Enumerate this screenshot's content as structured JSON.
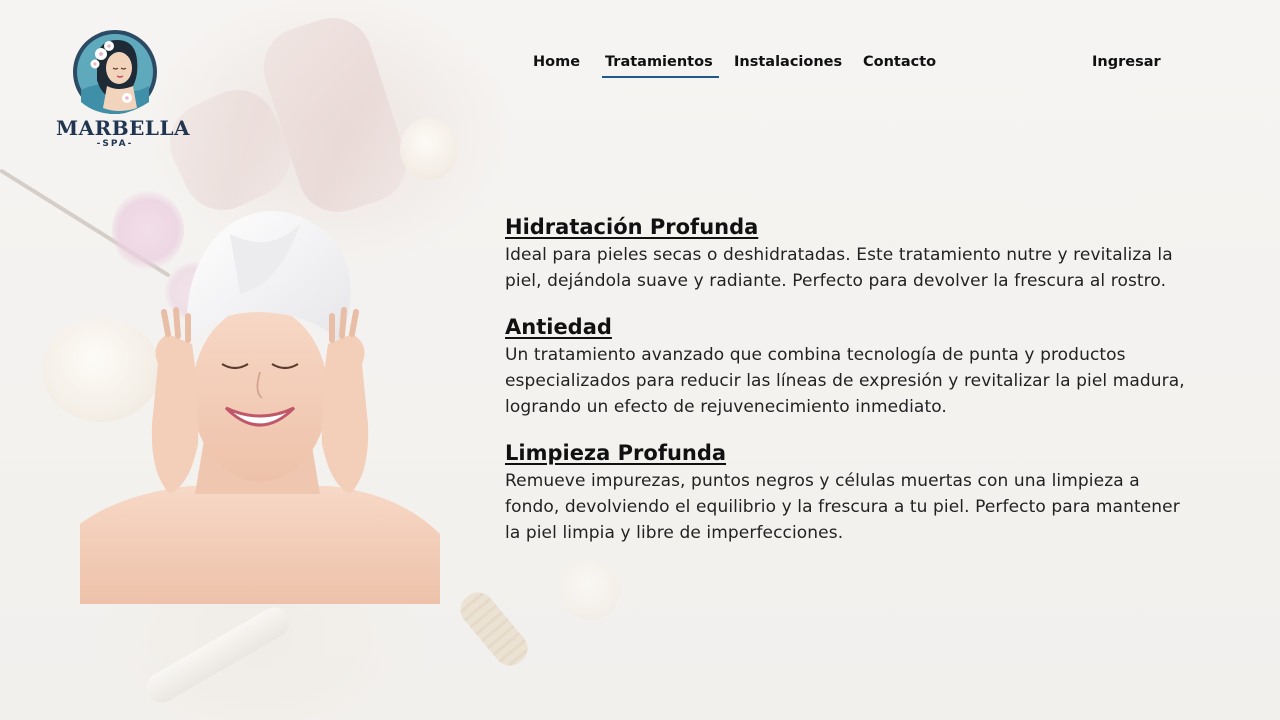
{
  "brand": {
    "name": "MARBELLA",
    "tagline": "SPA"
  },
  "nav": {
    "items": [
      {
        "label": "Home"
      },
      {
        "label": "Tratamientos"
      },
      {
        "label": "Instalaciones"
      },
      {
        "label": "Contacto"
      }
    ],
    "active": "Tratamientos",
    "login_label": "Ingresar"
  },
  "treatments": [
    {
      "title": "Hidratación Profunda",
      "description": "Ideal para pieles secas o deshidratadas. Este tratamiento nutre y revitaliza la piel, dejándola suave y radiante. Perfecto para devolver la frescura al rostro."
    },
    {
      "title": "Antiedad",
      "description": "Un tratamiento avanzado que combina tecnología de punta y productos especializados para reducir las líneas de expresión y revitalizar la piel madura, logrando un efecto de rejuvenecimiento inmediato."
    },
    {
      "title": "Limpieza Profunda",
      "description": "Remueve impurezas, puntos negros y células muertas con una limpieza a fondo, devolviendo el equilibrio y la frescura a tu piel. Perfecto para mantener la piel limpia y libre de imperfecciones."
    }
  ],
  "colors": {
    "brand_navy": "#1f3550",
    "nav_underline": "#1f5a8a",
    "logo_teal": "#3f8fa8"
  },
  "icons": {
    "logo": "woman-with-flowers-logo-icon"
  }
}
